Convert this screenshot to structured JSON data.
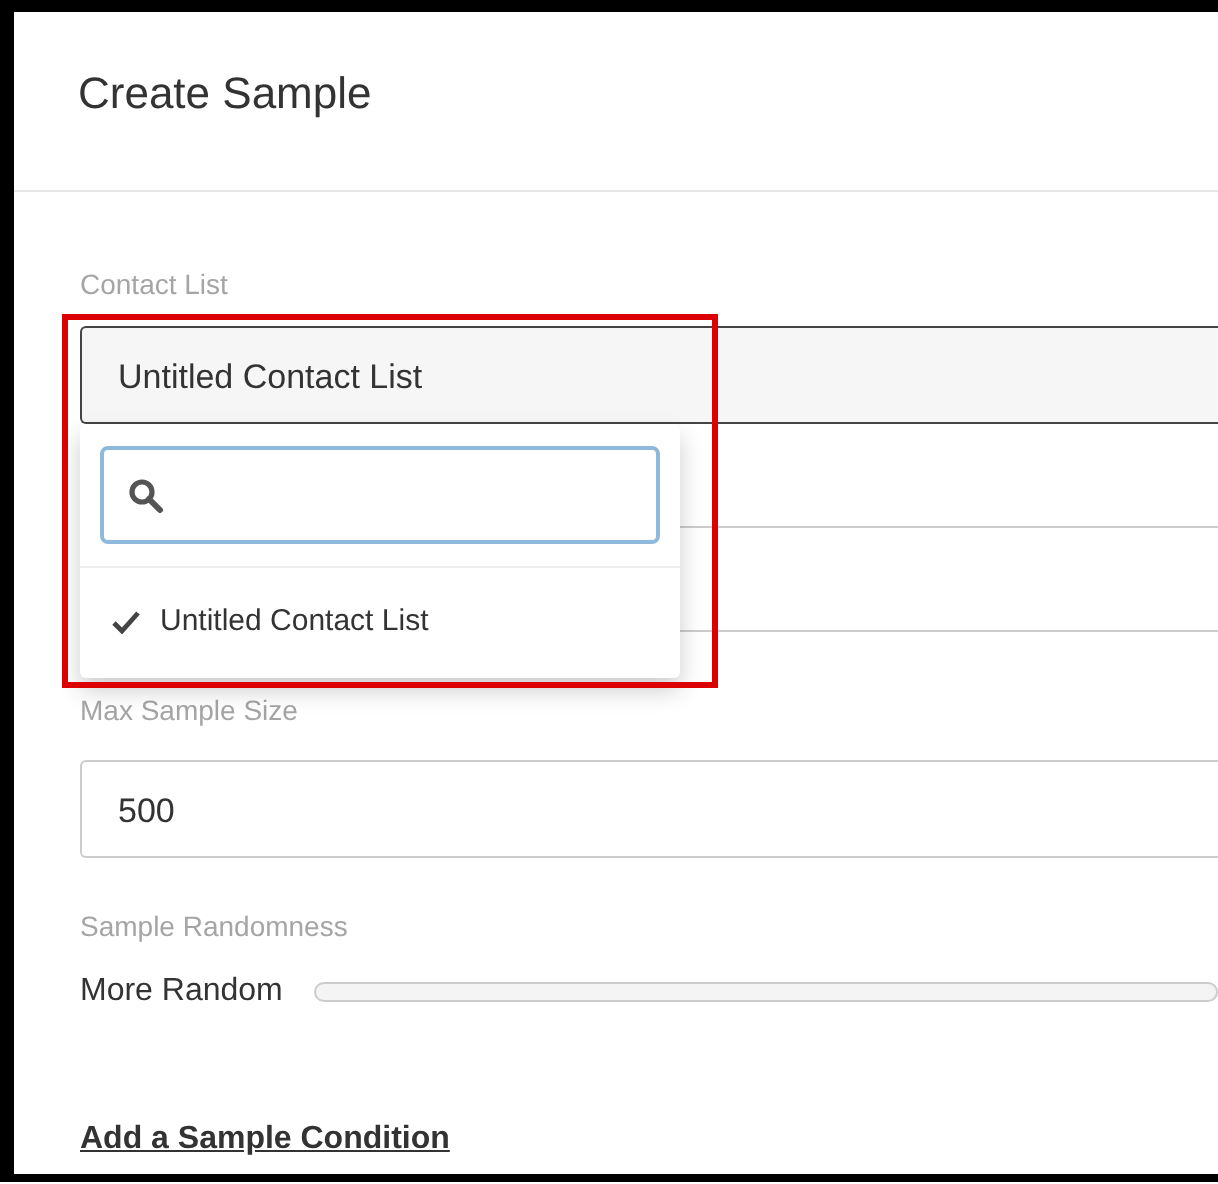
{
  "dialog": {
    "title": "Create Sample"
  },
  "contact_list": {
    "label": "Contact List",
    "value": "Untitled Contact List",
    "dropdown": {
      "options": [
        {
          "label": "Untitled Contact List",
          "selected": true
        }
      ]
    }
  },
  "max_sample_size": {
    "label": "Max Sample Size",
    "value": "500"
  },
  "sample_randomness": {
    "label": "Sample Randomness",
    "left_label": "More Random"
  },
  "link": "Add a Sample Condition"
}
